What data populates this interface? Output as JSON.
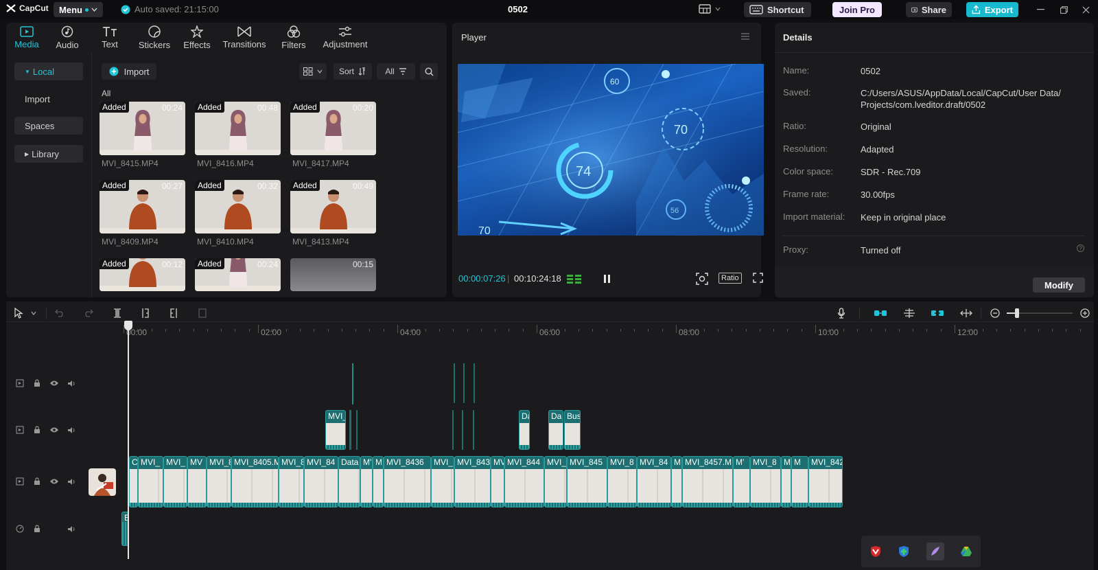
{
  "app": {
    "logo_text": "CapCut",
    "menu_label": "Menu",
    "autosave_text": "Auto saved: 21:15:00",
    "project_title": "0502",
    "shortcut_label": "Shortcut",
    "join_pro_label": "Join Pro",
    "share_label": "Share",
    "export_label": "Export",
    "accent_color": "#22c5d8"
  },
  "media_tabs": [
    {
      "label": "Media",
      "icon": "media-icon",
      "active": true
    },
    {
      "label": "Audio",
      "icon": "audio-icon"
    },
    {
      "label": "Text",
      "icon": "text-icon"
    },
    {
      "label": "Stickers",
      "icon": "stickers-icon"
    },
    {
      "label": "Effects",
      "icon": "effects-icon"
    },
    {
      "label": "Transitions",
      "icon": "transitions-icon"
    },
    {
      "label": "Filters",
      "icon": "filters-icon"
    },
    {
      "label": "Adjustment",
      "icon": "adjustment-icon"
    }
  ],
  "sidebar": {
    "local": "Local",
    "import": "Import",
    "spaces": "Spaces",
    "library": "Library"
  },
  "media_toolbar": {
    "import_label": "Import",
    "sort_label": "Sort",
    "filter_label": "All",
    "section_label": "All"
  },
  "media_items": [
    {
      "name": "MVI_8415.MP4",
      "badge": "Added",
      "duration": "00:24",
      "subject": "woman"
    },
    {
      "name": "MVI_8416.MP4",
      "badge": "Added",
      "duration": "00:48",
      "subject": "woman"
    },
    {
      "name": "MVI_8417.MP4",
      "badge": "Added",
      "duration": "00:20",
      "subject": "woman"
    },
    {
      "name": "MVI_8409.MP4",
      "badge": "Added",
      "duration": "00:27",
      "subject": "man"
    },
    {
      "name": "MVI_8410.MP4",
      "badge": "Added",
      "duration": "00:32",
      "subject": "man"
    },
    {
      "name": "MVI_8413.MP4",
      "badge": "Added",
      "duration": "00:49",
      "subject": "man"
    },
    {
      "name": "",
      "badge": "Added",
      "duration": "00:12",
      "subject": "man"
    },
    {
      "name": "",
      "badge": "Added",
      "duration": "00:24",
      "subject": "woman"
    },
    {
      "name": "",
      "badge": "",
      "duration": "00:15",
      "subject": "gray"
    }
  ],
  "player": {
    "title": "Player",
    "current_time": "00:00:07:26",
    "total_time": "00:10:24:18",
    "ratio_label": "Ratio",
    "overlay_numbers": [
      "60",
      "70",
      "74",
      "56",
      "70"
    ]
  },
  "details": {
    "title": "Details",
    "fields": [
      {
        "label": "Name:",
        "value": "0502"
      },
      {
        "label": "Saved:",
        "value": "C:/Users/ASUS/AppData/Local/CapCut/User Data/ Projects/com.lveditor.draft/0502"
      },
      {
        "label": "Ratio:",
        "value": "Original"
      },
      {
        "label": "Resolution:",
        "value": "Adapted"
      },
      {
        "label": "Color space:",
        "value": "SDR - Rec.709"
      },
      {
        "label": "Frame rate:",
        "value": "30.00fps"
      },
      {
        "label": "Import material:",
        "value": "Keep in original place"
      }
    ],
    "proxy_label": "Proxy:",
    "proxy_value": "Turned off",
    "modify_label": "Modify"
  },
  "timeline": {
    "ruler": [
      "00:00",
      "02:00",
      "04:00",
      "06:00",
      "08:00",
      "10:00",
      "12:00"
    ],
    "overlay_clips": [
      {
        "label": "MVI_"
      },
      {
        "label": "Da"
      },
      {
        "label": "Da"
      },
      {
        "label": "Bus"
      }
    ],
    "main_clips": [
      {
        "label": "C"
      },
      {
        "label": "MVI_"
      },
      {
        "label": "MVI_"
      },
      {
        "label": "MV"
      },
      {
        "label": "MVI_8"
      },
      {
        "label": "MVI_8405.M"
      },
      {
        "label": "MVI_8"
      },
      {
        "label": "MVI_84"
      },
      {
        "label": "Data"
      },
      {
        "label": "M'"
      },
      {
        "label": "M"
      },
      {
        "label": "MVI_8436"
      },
      {
        "label": "MVI_"
      },
      {
        "label": "MVI_843"
      },
      {
        "label": "MV"
      },
      {
        "label": "MVI_844"
      },
      {
        "label": "MVI_"
      },
      {
        "label": "MVI_845"
      },
      {
        "label": "MVI_8"
      },
      {
        "label": "MVI_84"
      },
      {
        "label": "M"
      },
      {
        "label": "MVI_8457.M"
      },
      {
        "label": "M'"
      },
      {
        "label": "MVI_8"
      },
      {
        "label": "M"
      },
      {
        "label": "M"
      },
      {
        "label": "MVI_842"
      }
    ],
    "audio_clip_label": "B"
  }
}
